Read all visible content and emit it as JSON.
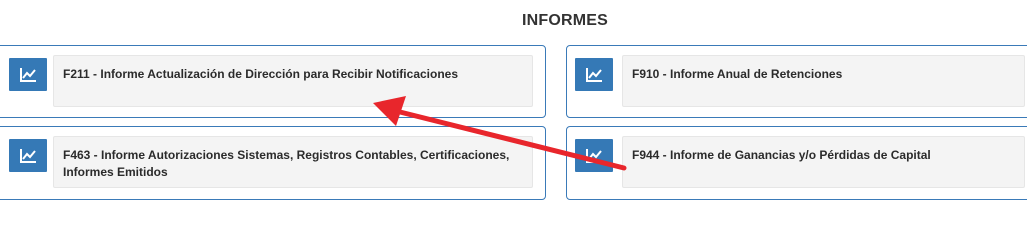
{
  "page": {
    "title": "INFORMES"
  },
  "cards": [
    {
      "label": "F211 - Informe Actualización de Dirección para Recibir Notificaciones",
      "icon": "chart-line-icon"
    },
    {
      "label": "F910 - Informe Anual de Retenciones",
      "icon": "chart-line-icon"
    },
    {
      "label": "F463 - Informe Autorizaciones Sistemas, Registros Contables, Certificaciones, Informes Emitidos",
      "icon": "chart-line-icon"
    },
    {
      "label": "F944 - Informe de Ganancias y/o Pérdidas de Capital",
      "icon": "chart-line-icon"
    }
  ],
  "colors": {
    "accent": "#3579b6",
    "border": "#3a7ab8",
    "annotation_arrow": "#e8262c"
  }
}
